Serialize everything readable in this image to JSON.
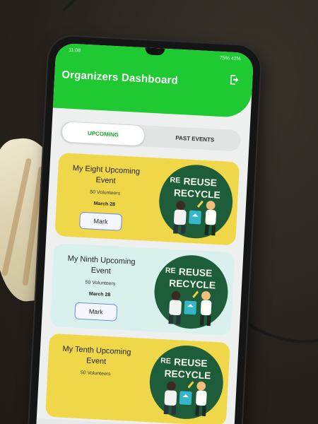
{
  "status": {
    "time": "11:08",
    "battery": "75% 42%"
  },
  "header": {
    "title": "Organizers Dashboard",
    "logout_icon": "logout-icon"
  },
  "tabs": [
    {
      "label": "UPCOMING",
      "active": true
    },
    {
      "label": "PAST EVENTS",
      "active": false
    }
  ],
  "art": {
    "line1": "REUSE",
    "line2": "RECYCLE",
    "corner": "RE"
  },
  "events": [
    {
      "title": "My Eight Upcoming Event",
      "volunteers": "50 Volunteers",
      "date": "March 28",
      "button": "Mark",
      "color": "#f0d74a"
    },
    {
      "title": "My Ninth Upcoming Event",
      "volunteers": "50 Volunteers",
      "date": "March 28",
      "button": "Mark",
      "color": "#d9f1ec"
    },
    {
      "title": "My Tenth Upcoming Event",
      "volunteers": "50 Volunteers",
      "date": "",
      "button": "",
      "color": "#f0d74a"
    }
  ],
  "colors": {
    "brand_green": "#1ec932",
    "tab_active_text": "#1aa52b"
  }
}
